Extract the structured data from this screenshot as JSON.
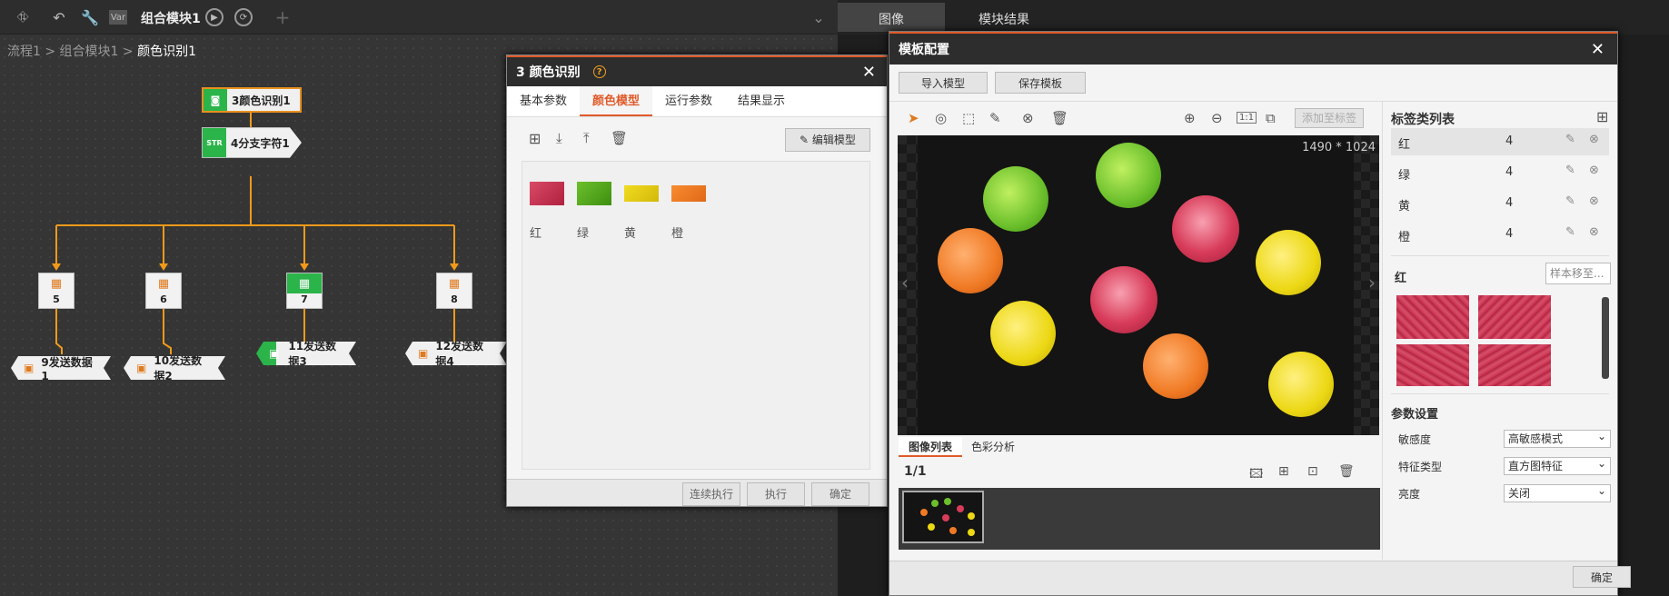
{
  "toolbar": {
    "title": "组合模块1",
    "icons": [
      "flow-icon",
      "undo-icon",
      "wrench-icon",
      "var-icon",
      "play-icon",
      "loop-icon",
      "add-icon"
    ],
    "var_label": "Var"
  },
  "right_tabs": {
    "image": "图像",
    "module_result": "模块结果"
  },
  "breadcrumb": {
    "path": "流程1 > 组合模块1 > ",
    "current": "颜色识别1"
  },
  "flow": {
    "color_node": "3颜色识别1",
    "split_node": "4分支字符1",
    "calc_nodes": [
      "5",
      "6",
      "7",
      "8"
    ],
    "send_nodes": [
      "9发送数据1",
      "10发送数据2",
      "11发送数据3",
      "12发送数据4"
    ]
  },
  "dialog1": {
    "title": "3 颜色识别",
    "tabs": [
      "基本参数",
      "颜色模型",
      "运行参数",
      "结果显示"
    ],
    "active_tab": "颜色模型",
    "edit_model": "编辑模型",
    "swatches": [
      {
        "label": "红",
        "color": "#c8304a"
      },
      {
        "label": "绿",
        "color": "#5aae1c"
      },
      {
        "label": "黄",
        "color": "#e8cc10"
      },
      {
        "label": "橙",
        "color": "#f07a24"
      }
    ],
    "buttons": {
      "continuous": "连续执行",
      "execute": "执行",
      "confirm": "确定"
    }
  },
  "dialog2": {
    "title": "模板配置",
    "import_model": "导入模型",
    "save_template": "保存模板",
    "add_to_label": "添加至标签",
    "image_size": "1490 * 1024",
    "zoom_label": "1:1",
    "tab_image_list": "图像列表",
    "tab_color_analysis": "色彩分析",
    "page": "1/1",
    "label_list_title": "标签类列表",
    "labels": [
      {
        "name": "红",
        "count": "4"
      },
      {
        "name": "绿",
        "count": "4"
      },
      {
        "name": "黄",
        "count": "4"
      },
      {
        "name": "橙",
        "count": "4"
      }
    ],
    "selected_label": "红",
    "move_samples": "样本移至...",
    "params_title": "参数设置",
    "params": [
      {
        "name": "敏感度",
        "value": "高敏感模式"
      },
      {
        "name": "特征类型",
        "value": "直方图特征"
      },
      {
        "name": "亮度",
        "value": "关闭"
      }
    ],
    "confirm": "确定"
  }
}
